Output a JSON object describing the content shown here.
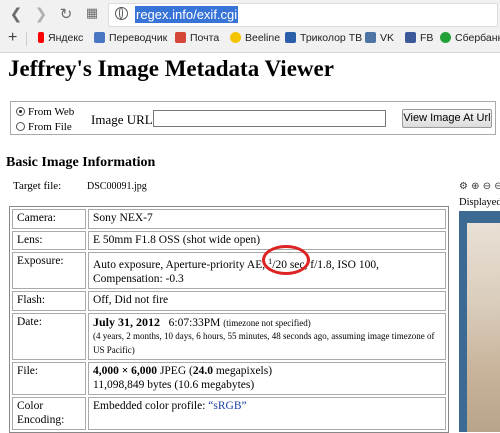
{
  "browser": {
    "url": "regex.info/exif.cgi",
    "bookmarks": [
      {
        "label": "Яндекс",
        "color": "#ff0000"
      },
      {
        "label": "Переводчик",
        "color": "#4a77c4"
      },
      {
        "label": "Почта",
        "color": "#d44638"
      },
      {
        "label": "Beeline",
        "color": "#f5c400"
      },
      {
        "label": "Триколор ТВ",
        "color": "#2a5ea8"
      },
      {
        "label": "VK",
        "color": "#4c75a3"
      },
      {
        "label": "FB",
        "color": "#3b5998"
      },
      {
        "label": "Сбербанк",
        "color": "#21a038"
      }
    ]
  },
  "page": {
    "title": "Jeffrey's Image Metadata Viewer",
    "form": {
      "radio_web": "From Web",
      "radio_file": "From File",
      "url_label": "Image URL:",
      "url_value": "",
      "submit": "View Image At Url"
    },
    "section_title": "Basic Image Information",
    "target_file_label": "Target file:",
    "target_file_value": "DSC00091.jpg",
    "rows": {
      "camera": {
        "label": "Camera:",
        "value": "Sony NEX-7"
      },
      "lens": {
        "label": "Lens:",
        "value": "E 50mm F1.8 OSS (shot wide open)"
      },
      "exposure": {
        "label": "Exposure:",
        "prefix": "Auto exposure, Aperture-priority AE, ",
        "num": "1",
        "den": "/20 sec",
        "suffix": ", f/1.8, ISO 100,",
        "line2": "Compensation: -0.3"
      },
      "flash": {
        "label": "Flash:",
        "value": "Off, Did not fire"
      },
      "date": {
        "label": "Date:",
        "date": "July 31, 2012",
        "time": "6:07:33PM",
        "tz_note": "(timezone not specified)",
        "ago": "(4 years, 2 months, 10 days, 6 hours, 55 minutes, 48 seconds ago, assuming image timezone of US Pacific)"
      },
      "file": {
        "label": "File:",
        "dims": "4,000 × 6,000",
        "type": "JPEG",
        "mp_open": "(",
        "mp": "24.0",
        "mp_close": "megapixels)",
        "bytes": "11,098,849 bytes (10.6 megabytes)"
      },
      "color": {
        "label": "Color Encoding:",
        "prefix": "Embedded color profile: ",
        "profile": "“sRGB”"
      }
    },
    "side": {
      "tools": "⚙ ⊕ ⊖ ⊖",
      "displayed": "Displayed"
    }
  }
}
